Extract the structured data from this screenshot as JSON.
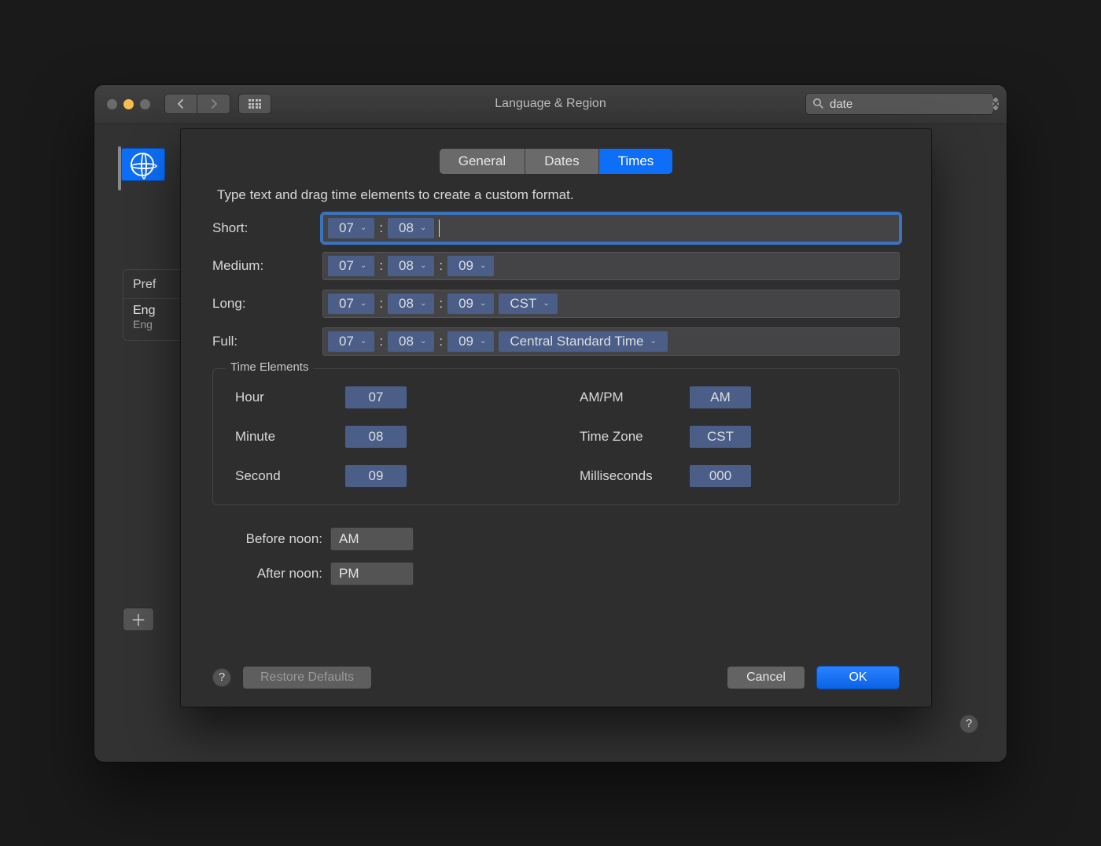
{
  "titlebar": {
    "title": "Language & Region",
    "search_value": "date"
  },
  "sidebar": {
    "header": "Pref",
    "lang_primary": "Eng",
    "lang_secondary": "Eng"
  },
  "sheet": {
    "tabs": {
      "general": "General",
      "dates": "Dates",
      "times": "Times"
    },
    "hint": "Type text and drag time elements to create a custom format.",
    "rows": {
      "short": {
        "label": "Short:",
        "tokens": [
          "07",
          "08"
        ]
      },
      "medium": {
        "label": "Medium:",
        "tokens": [
          "07",
          "08",
          "09"
        ]
      },
      "long": {
        "label": "Long:",
        "tokens": [
          "07",
          "08",
          "09"
        ],
        "tz": "CST"
      },
      "full": {
        "label": "Full:",
        "tokens": [
          "07",
          "08",
          "09"
        ],
        "tz": "Central Standard Time"
      }
    },
    "group_title": "Time Elements",
    "elements": {
      "hour": {
        "label": "Hour",
        "value": "07"
      },
      "minute": {
        "label": "Minute",
        "value": "08"
      },
      "second": {
        "label": "Second",
        "value": "09"
      },
      "ampm": {
        "label": "AM/PM",
        "value": "AM"
      },
      "tz": {
        "label": "Time Zone",
        "value": "CST"
      },
      "ms": {
        "label": "Milliseconds",
        "value": "000"
      }
    },
    "before_noon": {
      "label": "Before noon:",
      "value": "AM"
    },
    "after_noon": {
      "label": "After noon:",
      "value": "PM"
    },
    "buttons": {
      "restore": "Restore Defaults",
      "cancel": "Cancel",
      "ok": "OK"
    }
  }
}
